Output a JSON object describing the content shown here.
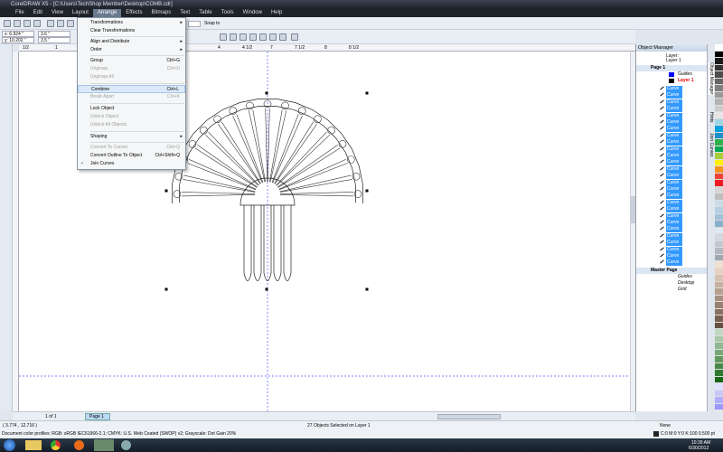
{
  "window": {
    "title": "CorelDRAW X5 - [C:\\Users\\TechShop Member\\Desktop\\COMB.cdr]"
  },
  "menubar": [
    "File",
    "Edit",
    "View",
    "Layout",
    "Arrange",
    "Effects",
    "Bitmaps",
    "Text",
    "Table",
    "Tools",
    "Window",
    "Help"
  ],
  "toolbar": {
    "snap_to": "Snap to"
  },
  "propbar": {
    "x": "x: 6.924 \"",
    "y": "y: 10.202 \"",
    "w": "3.6 \"",
    "h": "3.5 \""
  },
  "ruler": {
    "ticks": [
      "1/2",
      "1",
      "4",
      "4 1/2",
      "7",
      "7 1/2",
      "8",
      "8 1/2"
    ]
  },
  "arrange_menu": {
    "items": [
      {
        "label": "Transformations",
        "shortcut": "",
        "submenu": true,
        "disabled": false
      },
      {
        "label": "Clear Transformations",
        "shortcut": "",
        "submenu": false,
        "disabled": false
      },
      {
        "label": "Align and Distribute",
        "shortcut": "",
        "submenu": true,
        "disabled": false
      },
      {
        "label": "Order",
        "shortcut": "",
        "submenu": true,
        "disabled": false
      },
      {
        "label": "Group",
        "shortcut": "Ctrl+G",
        "submenu": false,
        "disabled": false
      },
      {
        "label": "Ungroup",
        "shortcut": "Ctrl+U",
        "submenu": false,
        "disabled": true
      },
      {
        "label": "Ungroup All",
        "shortcut": "",
        "submenu": false,
        "disabled": true
      },
      {
        "label": "Combine",
        "shortcut": "Ctrl+L",
        "submenu": false,
        "disabled": false,
        "highlighted": true
      },
      {
        "label": "Break Apart",
        "shortcut": "Ctrl+K",
        "submenu": false,
        "disabled": true
      },
      {
        "label": "Lock Object",
        "shortcut": "",
        "submenu": false,
        "disabled": false
      },
      {
        "label": "Unlock Object",
        "shortcut": "",
        "submenu": false,
        "disabled": true
      },
      {
        "label": "Unlock All Objects",
        "shortcut": "",
        "submenu": false,
        "disabled": true
      },
      {
        "label": "Shaping",
        "shortcut": "",
        "submenu": true,
        "disabled": false
      },
      {
        "label": "Convert To Curves",
        "shortcut": "Ctrl+Q",
        "submenu": false,
        "disabled": true
      },
      {
        "label": "Convert Outline To Object",
        "shortcut": "Ctrl+Shift+Q",
        "submenu": false,
        "disabled": false
      },
      {
        "label": "Join Curves",
        "shortcut": "",
        "submenu": false,
        "disabled": false,
        "checked": true
      }
    ]
  },
  "object_manager": {
    "title": "Object Manager",
    "layer_label": "Layer:",
    "layer_value": "Layer 1",
    "page": "Page 1",
    "guides": "Guides",
    "layer1": "Layer 1",
    "curves": [
      "Curve",
      "Curve",
      "Curve",
      "Curve",
      "Curve",
      "Curve",
      "Curve",
      "Curve",
      "Curve",
      "Curve",
      "Curve",
      "Curve",
      "Curve",
      "Curve",
      "Curve",
      "Curve",
      "Curve",
      "Curve",
      "Curve",
      "Curve",
      "Curve",
      "Curve",
      "Curve",
      "Curve",
      "Curve",
      "Curve",
      "Curve"
    ],
    "master_page": "Master Page",
    "master_layers": [
      "Guides",
      "Desktop",
      "Grid"
    ]
  },
  "docker_tabs": [
    "Object Manager",
    "Hints",
    "Join Curves"
  ],
  "pagebar": {
    "count": "1 of 1",
    "tab": "Page 1"
  },
  "status": {
    "coords": "( 3.774 , 12.716 )",
    "selection": "27 Objects Selected on Layer 1",
    "profiles": "Document color profiles: RGB: sRGB IEC61966-2.1; CMYK: U.S. Web Coated (SWOP) v2; Grayscale: Dot Gain 20%",
    "fill": "None",
    "outline": "C:0 M:0 Y:0 K:100  0.500 pt"
  },
  "taskbar": {
    "time": "10:39 AM",
    "date": "6/30/2012"
  },
  "palette": [
    "#ffffff",
    "#000000",
    "#1a1a1a",
    "#333333",
    "#4d4d4d",
    "#666666",
    "#808080",
    "#999999",
    "#b3b3b3",
    "#cccccc",
    "#e6e6e6",
    "#9fd3e6",
    "#00a0e0",
    "#1e8fc8",
    "#2db04b",
    "#00a651",
    "#a6ce39",
    "#fff200",
    "#f7941d",
    "#ef4136",
    "#ed1c24",
    "#d6d6d6",
    "#bfbfbf",
    "#c8dde8",
    "#b4cfe0",
    "#a0c0d8",
    "#88b0cc",
    "#e0e8f0",
    "#d0d8e0",
    "#c0c8d0",
    "#b0b8c0",
    "#a0a8b0",
    "#f0e0d0",
    "#e8d0c0",
    "#d8c0b0",
    "#c8b0a0",
    "#b8a090",
    "#a89080",
    "#988070",
    "#887060",
    "#786050",
    "#685040",
    "#c0d8c0",
    "#a8c8a8",
    "#90b890",
    "#78a878",
    "#609860",
    "#488848",
    "#307830",
    "#186818",
    "#e0e0ff",
    "#c8c8ff",
    "#b0b0ff",
    "#9898ff"
  ]
}
